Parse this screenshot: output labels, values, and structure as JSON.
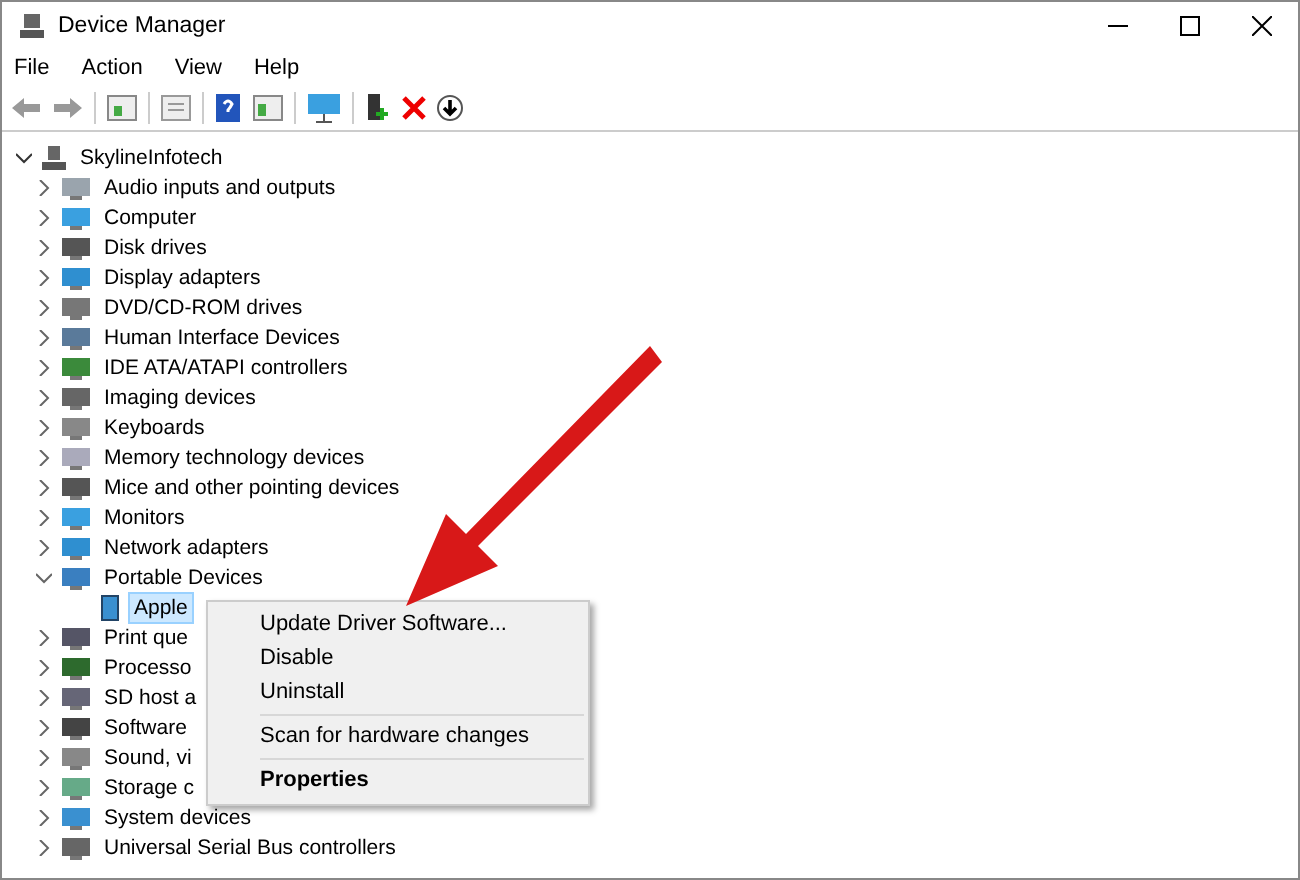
{
  "window": {
    "title": "Device Manager"
  },
  "menu": [
    "File",
    "Action",
    "View",
    "Help"
  ],
  "tree": {
    "label": "SkylineInfotech",
    "expanded": true,
    "selected": false,
    "children": [
      {
        "label": "Audio inputs and outputs",
        "expanded": false,
        "selected": false
      },
      {
        "label": "Computer",
        "expanded": false,
        "selected": false
      },
      {
        "label": "Disk drives",
        "expanded": false,
        "selected": false
      },
      {
        "label": "Display adapters",
        "expanded": false,
        "selected": false
      },
      {
        "label": "DVD/CD-ROM drives",
        "expanded": false,
        "selected": false
      },
      {
        "label": "Human Interface Devices",
        "expanded": false,
        "selected": false
      },
      {
        "label": "IDE ATA/ATAPI controllers",
        "expanded": false,
        "selected": false
      },
      {
        "label": "Imaging devices",
        "expanded": false,
        "selected": false
      },
      {
        "label": "Keyboards",
        "expanded": false,
        "selected": false
      },
      {
        "label": "Memory technology devices",
        "expanded": false,
        "selected": false
      },
      {
        "label": "Mice and other pointing devices",
        "expanded": false,
        "selected": false
      },
      {
        "label": "Monitors",
        "expanded": false,
        "selected": false
      },
      {
        "label": "Network adapters",
        "expanded": false,
        "selected": false
      },
      {
        "label": "Portable Devices",
        "expanded": true,
        "selected": false,
        "children": [
          {
            "label": "Apple",
            "selected": true
          }
        ]
      },
      {
        "label": "Print que",
        "expanded": false,
        "selected": false
      },
      {
        "label": "Processo",
        "expanded": false,
        "selected": false
      },
      {
        "label": "SD host a",
        "expanded": false,
        "selected": false
      },
      {
        "label": "Software",
        "expanded": false,
        "selected": false
      },
      {
        "label": "Sound, vi",
        "expanded": false,
        "selected": false
      },
      {
        "label": "Storage c",
        "expanded": false,
        "selected": false
      },
      {
        "label": "System devices",
        "expanded": false,
        "selected": false
      },
      {
        "label": "Universal Serial Bus controllers",
        "expanded": false,
        "selected": false
      }
    ]
  },
  "context_menu": [
    {
      "label": "Update Driver Software...",
      "kind": "item"
    },
    {
      "label": "Disable",
      "kind": "item"
    },
    {
      "label": "Uninstall",
      "kind": "item"
    },
    {
      "kind": "separator"
    },
    {
      "label": "Scan for hardware changes",
      "kind": "item"
    },
    {
      "kind": "separator"
    },
    {
      "label": "Properties",
      "kind": "default"
    }
  ]
}
